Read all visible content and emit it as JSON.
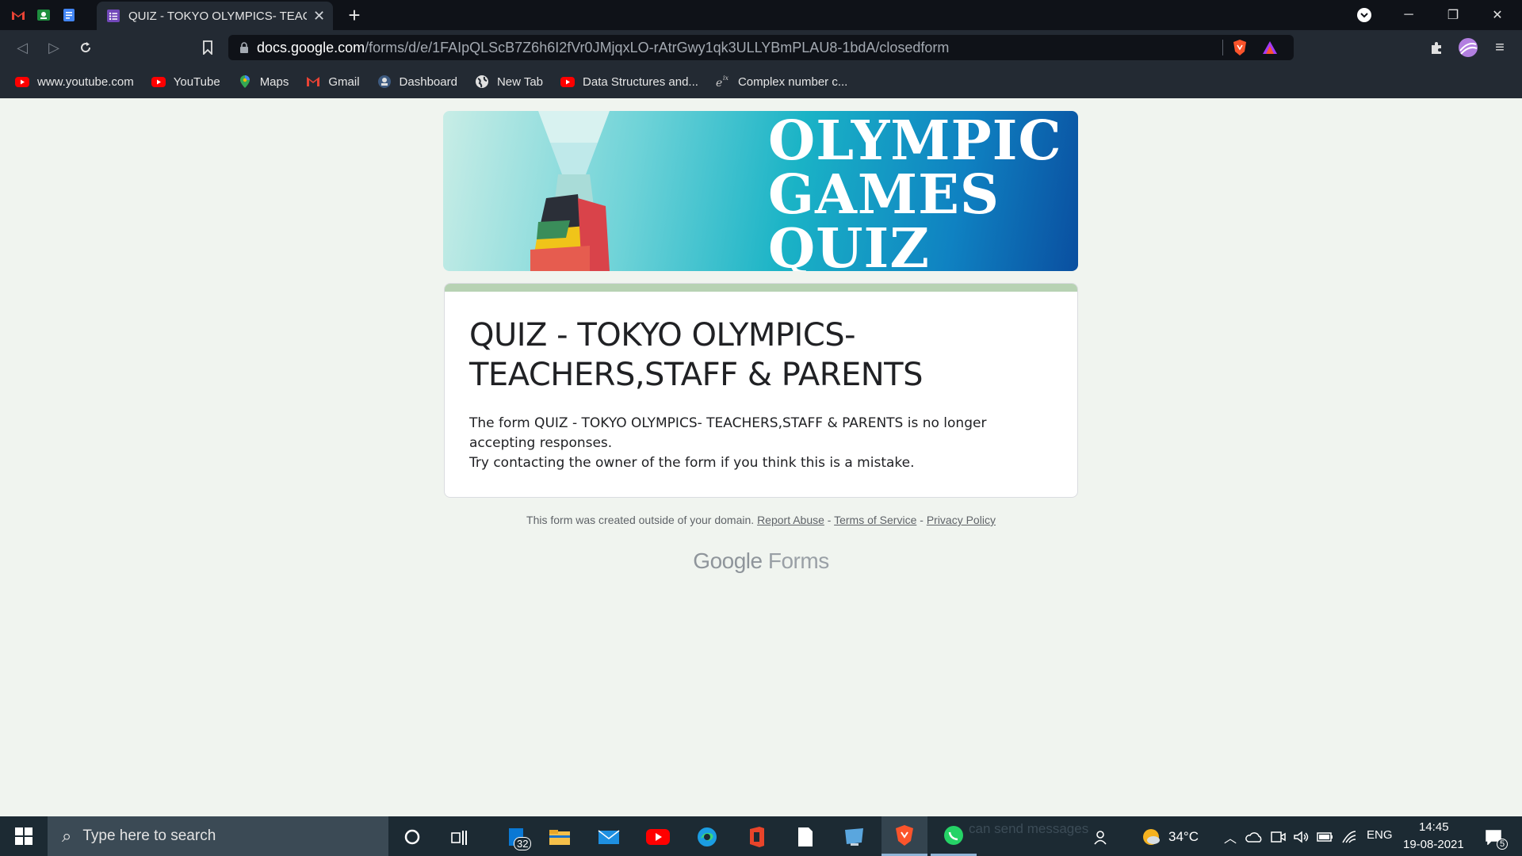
{
  "browser": {
    "active_tab_title": "QUIZ - TOKYO OLYMPICS- TEACH",
    "url_domain": "docs.google.com",
    "url_path": "/forms/d/e/1FAIpQLScB7Z6h6I2fVr0JMjqxLO-rAtrGwy1qk3ULLYBmPLAU8-1bdA/closedform",
    "bookmarks": [
      {
        "label": "www.youtube.com",
        "icon": "youtube-icon"
      },
      {
        "label": "YouTube",
        "icon": "youtube-icon"
      },
      {
        "label": "Maps",
        "icon": "maps-icon"
      },
      {
        "label": "Gmail",
        "icon": "gmail-icon"
      },
      {
        "label": "Dashboard",
        "icon": "dashboard-icon"
      },
      {
        "label": "New Tab",
        "icon": "globe-icon"
      },
      {
        "label": "Data Structures and...",
        "icon": "youtube-icon"
      },
      {
        "label": "Complex number c...",
        "icon": "complex-number-icon"
      }
    ]
  },
  "page": {
    "banner_text_line1": "OLYMPIC",
    "banner_text_line2": "GAMES",
    "banner_text_line3": "QUIZ",
    "form_title": "QUIZ - TOKYO OLYMPICS- TEACHERS,STAFF & PARENTS",
    "closed_message_line1": "The form QUIZ - TOKYO OLYMPICS- TEACHERS,STAFF & PARENTS is no longer accepting responses.",
    "closed_message_line2": "Try contacting the owner of the form if you think this is a mistake.",
    "footer_prefix": "This form was created outside of your domain.",
    "footer_link_abuse": "Report Abuse",
    "footer_link_terms": "Terms of Service",
    "footer_link_privacy": "Privacy Policy",
    "footer_sep": " - ",
    "logo_google": "Google",
    "logo_forms": "Forms"
  },
  "taskbar": {
    "search_placeholder": "Type here to search",
    "mail_badge": "32",
    "weather": "34°C",
    "language": "ENG",
    "time": "14:45",
    "date": "19-08-2021",
    "notification_count": "5",
    "ghost_text": "can send messages"
  },
  "colors": {
    "accent_stripe": "#b7d2b3",
    "page_bg": "#f0f4ef",
    "chrome_dark": "#0f1218",
    "chrome_toolbar": "#232a33"
  }
}
